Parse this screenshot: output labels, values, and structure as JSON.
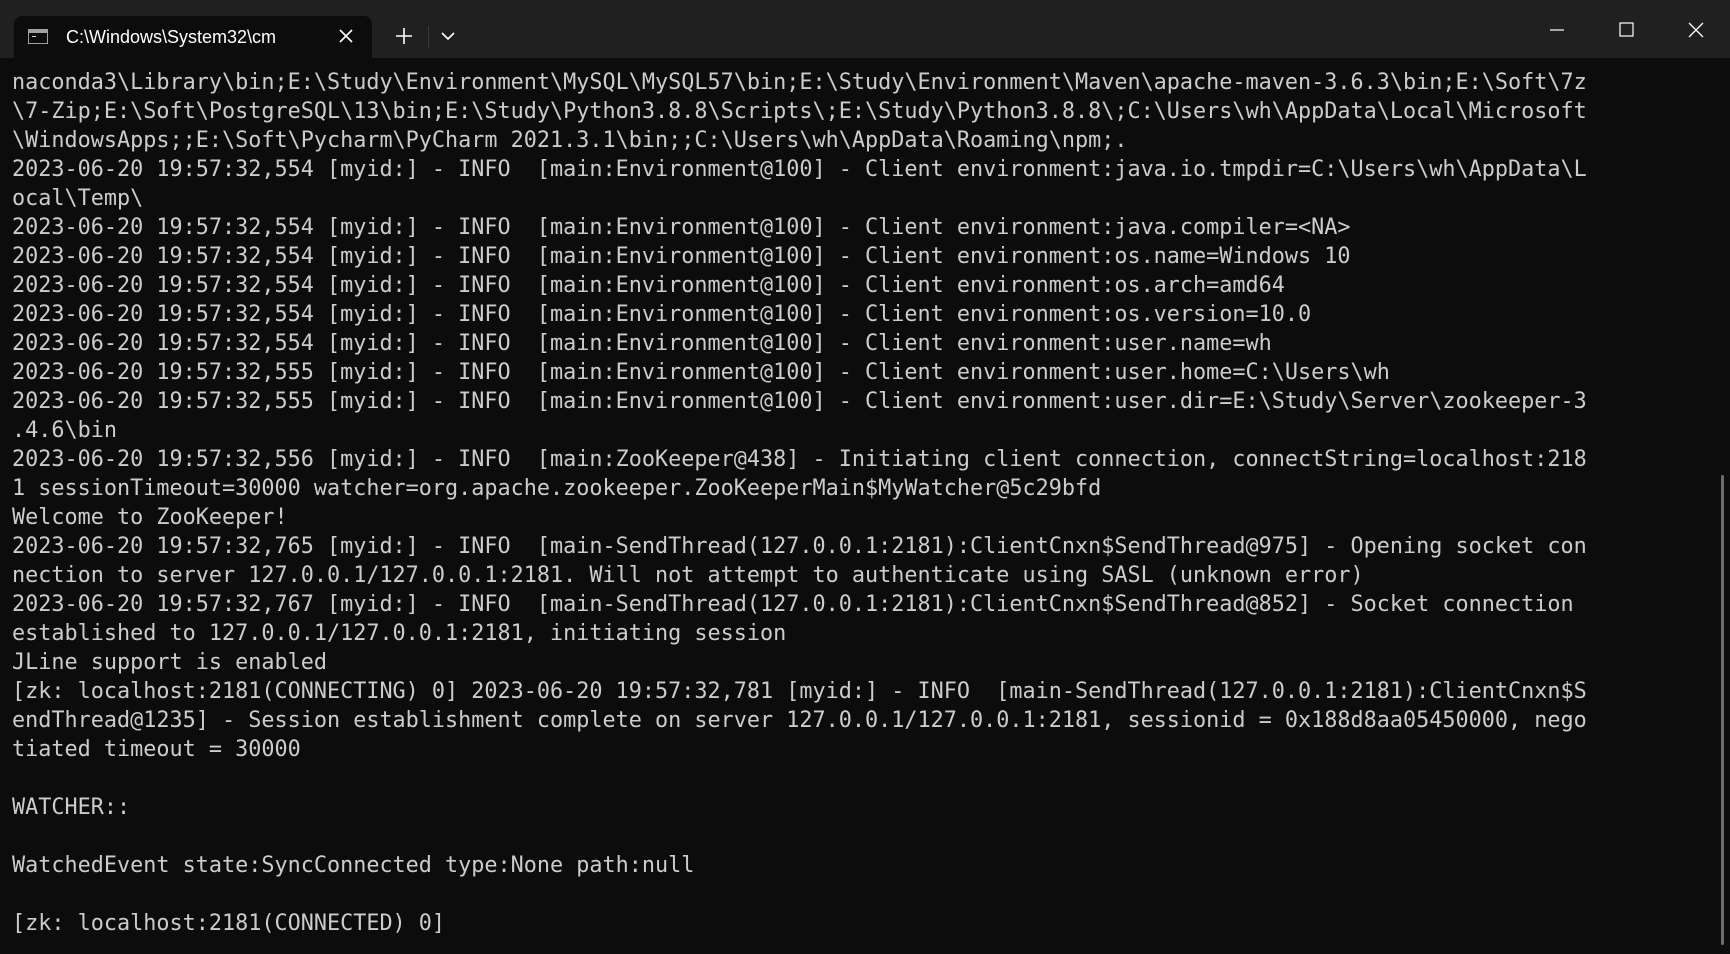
{
  "window": {
    "tab_title": "C:\\Windows\\System32\\cm"
  },
  "icons": {
    "tab": "console-icon",
    "close_tab": "close-icon",
    "new_tab": "plus-icon",
    "dropdown": "chevron-down-icon",
    "minimize": "minimize-icon",
    "maximize": "maximize-icon",
    "close_window": "close-icon"
  },
  "colors": {
    "background": "#0c0c0c",
    "titlebar": "#202020",
    "text": "#cccccc"
  },
  "terminal": {
    "lines": [
      "naconda3\\Library\\bin;E:\\Study\\Environment\\MySQL\\MySQL57\\bin;E:\\Study\\Environment\\Maven\\apache-maven-3.6.3\\bin;E:\\Soft\\7z",
      "\\7-Zip;E:\\Soft\\PostgreSQL\\13\\bin;E:\\Study\\Python3.8.8\\Scripts\\;E:\\Study\\Python3.8.8\\;C:\\Users\\wh\\AppData\\Local\\Microsoft",
      "\\WindowsApps;;E:\\Soft\\Pycharm\\PyCharm 2021.3.1\\bin;;C:\\Users\\wh\\AppData\\Roaming\\npm;.",
      "2023-06-20 19:57:32,554 [myid:] - INFO  [main:Environment@100] - Client environment:java.io.tmpdir=C:\\Users\\wh\\AppData\\L",
      "ocal\\Temp\\",
      "2023-06-20 19:57:32,554 [myid:] - INFO  [main:Environment@100] - Client environment:java.compiler=<NA>",
      "2023-06-20 19:57:32,554 [myid:] - INFO  [main:Environment@100] - Client environment:os.name=Windows 10",
      "2023-06-20 19:57:32,554 [myid:] - INFO  [main:Environment@100] - Client environment:os.arch=amd64",
      "2023-06-20 19:57:32,554 [myid:] - INFO  [main:Environment@100] - Client environment:os.version=10.0",
      "2023-06-20 19:57:32,554 [myid:] - INFO  [main:Environment@100] - Client environment:user.name=wh",
      "2023-06-20 19:57:32,555 [myid:] - INFO  [main:Environment@100] - Client environment:user.home=C:\\Users\\wh",
      "2023-06-20 19:57:32,555 [myid:] - INFO  [main:Environment@100] - Client environment:user.dir=E:\\Study\\Server\\zookeeper-3",
      ".4.6\\bin",
      "2023-06-20 19:57:32,556 [myid:] - INFO  [main:ZooKeeper@438] - Initiating client connection, connectString=localhost:218",
      "1 sessionTimeout=30000 watcher=org.apache.zookeeper.ZooKeeperMain$MyWatcher@5c29bfd",
      "Welcome to ZooKeeper!",
      "2023-06-20 19:57:32,765 [myid:] - INFO  [main-SendThread(127.0.0.1:2181):ClientCnxn$SendThread@975] - Opening socket con",
      "nection to server 127.0.0.1/127.0.0.1:2181. Will not attempt to authenticate using SASL (unknown error)",
      "2023-06-20 19:57:32,767 [myid:] - INFO  [main-SendThread(127.0.0.1:2181):ClientCnxn$SendThread@852] - Socket connection",
      "established to 127.0.0.1/127.0.0.1:2181, initiating session",
      "JLine support is enabled",
      "[zk: localhost:2181(CONNECTING) 0] 2023-06-20 19:57:32,781 [myid:] - INFO  [main-SendThread(127.0.0.1:2181):ClientCnxn$S",
      "endThread@1235] - Session establishment complete on server 127.0.0.1/127.0.0.1:2181, sessionid = 0x188d8aa05450000, nego",
      "tiated timeout = 30000",
      "",
      "WATCHER::",
      "",
      "WatchedEvent state:SyncConnected type:None path:null",
      "",
      "[zk: localhost:2181(CONNECTED) 0]"
    ]
  }
}
